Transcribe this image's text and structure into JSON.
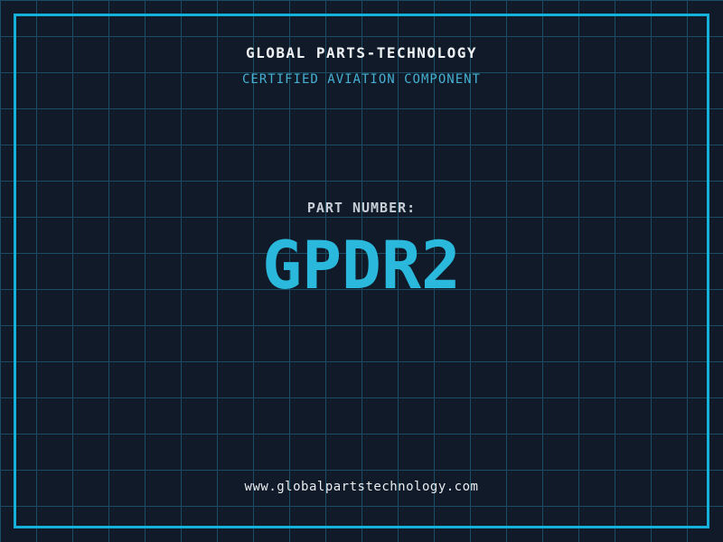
{
  "header": {
    "title": "GLOBAL PARTS-TECHNOLOGY",
    "subtitle": "CERTIFIED AVIATION COMPONENT"
  },
  "main": {
    "part_label": "PART NUMBER:",
    "part_number": "GPDR2"
  },
  "footer": {
    "url": "www.globalpartstechnology.com"
  },
  "colors": {
    "background": "#101a28",
    "grid_line": "#1b4d62",
    "frame": "#14b2da",
    "title": "#eef2f5",
    "subtitle": "#46b0d2",
    "part_label": "#c7ced6",
    "part_number": "#2ab8dc",
    "url": "#e9edf0"
  }
}
